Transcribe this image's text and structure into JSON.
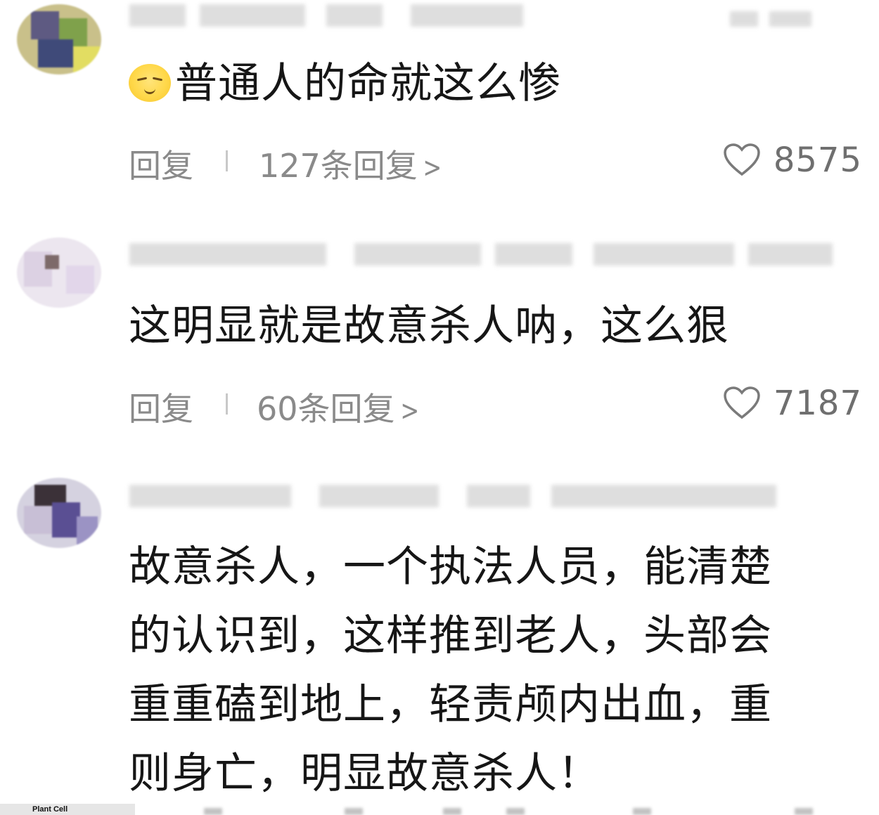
{
  "comments": [
    {
      "text": "普通人的命就这么惨",
      "has_emoji": true,
      "emoji_name": "smirk-face-icon",
      "reply_label": "回复",
      "replies_label": "127条回复",
      "likes": "8575"
    },
    {
      "text": "这明显就是故意杀人呐，这么狠",
      "has_emoji": false,
      "reply_label": "回复",
      "replies_label": "60条回复",
      "likes": "7187"
    },
    {
      "text_lines": [
        "故意杀人，一个执法人员，能清楚",
        "的认识到，这样推到老人，头部会",
        "重重磕到地上，轻责颅内出血，重",
        "则身亡，明显故意杀人！"
      ]
    }
  ],
  "footer": {
    "label": "Plant Cell"
  },
  "colors": {
    "text": "#161616",
    "muted": "#8a8a8a",
    "like_icon": "#7a7a7a"
  }
}
